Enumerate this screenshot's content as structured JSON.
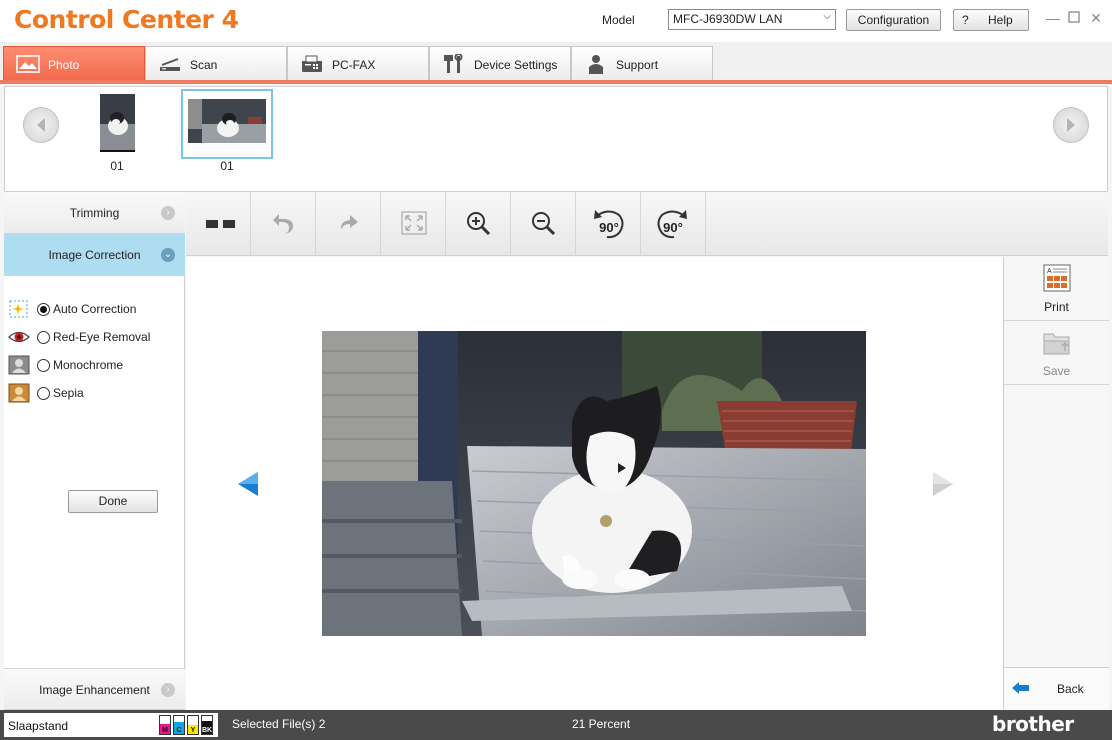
{
  "app": {
    "title": "Control Center 4",
    "model_label": "Model",
    "model_value": "MFC-J6930DW LAN",
    "configuration": "Configuration",
    "help_icon": "?",
    "help": "Help"
  },
  "tabs": [
    {
      "label": "Photo",
      "icon": "photo-icon",
      "active": true
    },
    {
      "label": "Scan",
      "icon": "scanner-icon",
      "active": false
    },
    {
      "label": "PC-FAX",
      "icon": "fax-icon",
      "active": false
    },
    {
      "label": "Device Settings",
      "icon": "tools-icon",
      "active": false
    },
    {
      "label": "Support",
      "icon": "person-icon",
      "active": false
    }
  ],
  "thumbnails": [
    {
      "label": "01",
      "selected": false
    },
    {
      "label": "01",
      "selected": true
    }
  ],
  "left_panel": {
    "trimming": "Trimming",
    "image_correction": "Image Correction",
    "options": [
      {
        "label": "Auto Correction",
        "checked": true,
        "icon": "auto-correction-icon"
      },
      {
        "label": "Red-Eye Removal",
        "checked": false,
        "icon": "red-eye-icon"
      },
      {
        "label": "Monochrome",
        "checked": false,
        "icon": "monochrome-icon"
      },
      {
        "label": "Sepia",
        "checked": false,
        "icon": "sepia-icon"
      }
    ],
    "done": "Done",
    "image_enhancement": "Image Enhancement"
  },
  "toolbar": {
    "tools": [
      "view-toggle-icon",
      "undo-icon",
      "redo-icon",
      "fit-to-window-icon",
      "zoom-in-icon",
      "zoom-out-icon",
      "rotate-left-90-icon",
      "rotate-right-90-icon"
    ],
    "rotate_left_label": "90°",
    "rotate_right_label": "90°"
  },
  "right_panel": {
    "print": "Print",
    "save": "Save",
    "back": "Back"
  },
  "status": {
    "state": "Slaapstand",
    "ink_labels": [
      "M",
      "C",
      "Y",
      "BK"
    ],
    "ink_colors": [
      "#e8178a",
      "#12a6dc",
      "#ffe600",
      "#111111"
    ],
    "ink_levels": [
      0.55,
      0.65,
      0.5,
      0.7
    ],
    "selected": "Selected File(s) 2",
    "zoom": "21 Percent",
    "brand": "brother"
  },
  "colors": {
    "accent": "#f07820",
    "tab_active": "#f26a4e",
    "accordion_active": "#aedcf0",
    "nav_arrow_active": "#1a7fd0"
  }
}
